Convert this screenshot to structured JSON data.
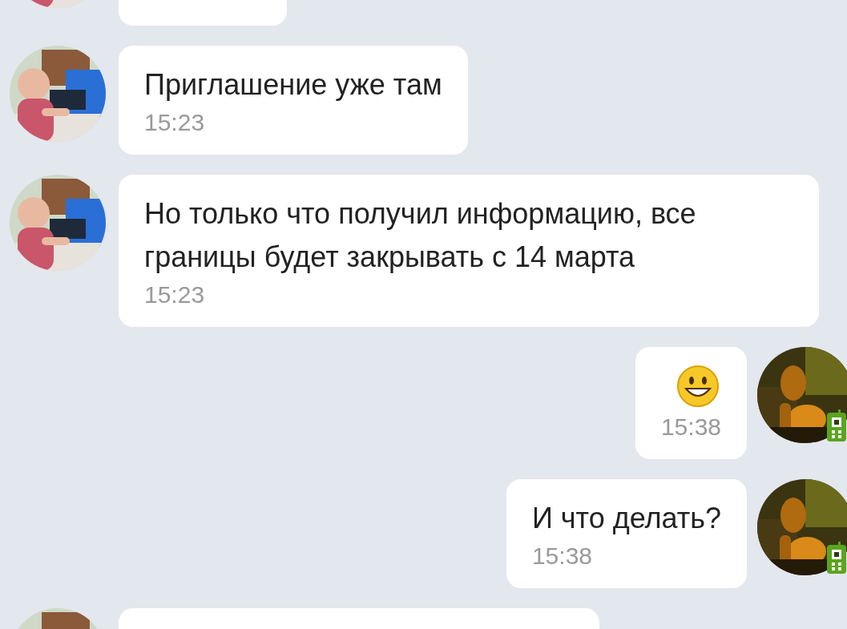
{
  "messages": [
    {
      "outgoing": false,
      "kind": "stub"
    },
    {
      "outgoing": false,
      "kind": "text",
      "text": "Приглашение уже там",
      "time": "15:23"
    },
    {
      "outgoing": false,
      "kind": "text",
      "text": "Но только что получил информацию, все границы будет закрывать с 14 марта",
      "time": "15:23"
    },
    {
      "outgoing": true,
      "kind": "emoji",
      "time": "15:38",
      "mobile": true
    },
    {
      "outgoing": true,
      "kind": "text",
      "text": "И что делать?",
      "time": "15:38",
      "mobile": true
    },
    {
      "outgoing": false,
      "kind": "stub"
    }
  ]
}
